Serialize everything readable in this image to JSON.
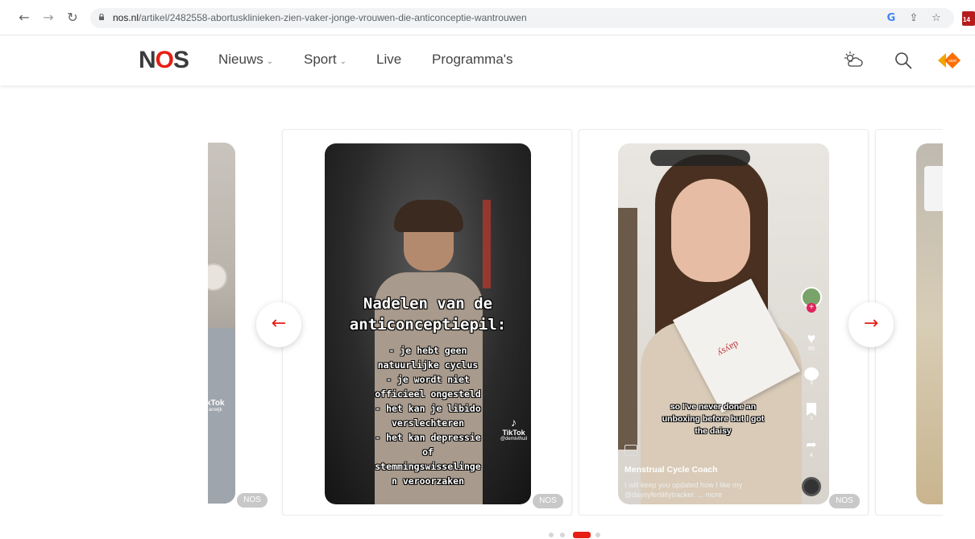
{
  "browser": {
    "url_host": "nos.nl",
    "url_path": "/artikel/2482558-abortusklinieken-zien-vaker-jonge-vrouwen-die-anticonceptie-wantrouwen",
    "back_icon": "arrow-left",
    "forward_icon": "arrow-right",
    "reload_icon": "reload",
    "google_label": "G",
    "calendar_badge": "14"
  },
  "header": {
    "logo_left": "N",
    "logo_o": "O",
    "logo_right": "S",
    "nav": {
      "news": "Nieuws",
      "sport": "Sport",
      "live": "Live",
      "programs": "Programma's"
    },
    "accent": "#e61e14"
  },
  "carousel": {
    "badge": "NOS",
    "card1": {
      "tiktok": "kTok",
      "handle": "anwijk"
    },
    "card2": {
      "title_line1": "Nadelen van de",
      "title_line2": "anticonceptiepil:",
      "lines": [
        "- je hebt geen",
        "natuurlijke cyclus",
        "- je wordt niet",
        "officieel ongesteld",
        "- het kan je libido",
        "verslechteren",
        "- het kan depressie",
        "of",
        "stemmingswisselinge",
        "n veroorzaken"
      ],
      "tiktok": "TikTok",
      "handle": "@demivthuil"
    },
    "card3": {
      "caption": "so I've never done an unboxing before but I got the daisy",
      "creator": "Menstrual Cycle Coach",
      "desc_line1": "I will keep you updated how I like my",
      "desc_line2": "@daysyfertilitytracker. ... more",
      "box_text": "daysy",
      "likes": "65",
      "comments": "3",
      "saves": "1",
      "shares": "4"
    },
    "prev_icon": "arrow-left",
    "next_icon": "arrow-right",
    "active_page": 3,
    "page_count": 4
  }
}
